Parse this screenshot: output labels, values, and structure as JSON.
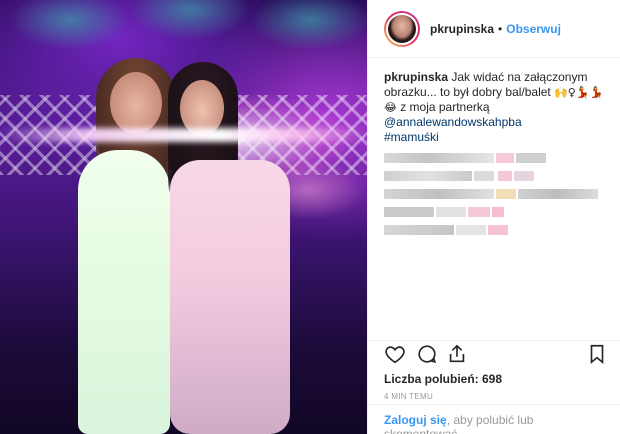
{
  "post": {
    "image_alt": "Dwie kobiety w długich sukniach na balu",
    "header": {
      "username": "pkrupinska",
      "separator": "•",
      "follow_label": "Obserwuj"
    },
    "caption": {
      "username": "pkrupinska",
      "text": "Jak widać na załączonym obrazku... to był dobry bal/balet",
      "emojis_line1": "🙌♀💃💃",
      "emojis_line2": "😂",
      "line2_text": "z moja partnerką",
      "mention": "@annalewandowskahpba",
      "hashtag": "#mamuśki"
    },
    "likes_text": "Liczba polubień: 698",
    "timestamp": "4 MIN TEMU",
    "login_prompt": {
      "link_label": "Zaloguj się",
      "rest": ", aby polubić lub skomentować."
    }
  },
  "icons": {
    "heart": "heart-icon",
    "comment": "comment-icon",
    "share": "share-icon",
    "bookmark": "bookmark-icon"
  },
  "colors": {
    "link_blue": "#3897f0",
    "mention_blue": "#003569",
    "text_dark": "#262626",
    "muted_gray": "#999999",
    "divider": "#efefef"
  }
}
